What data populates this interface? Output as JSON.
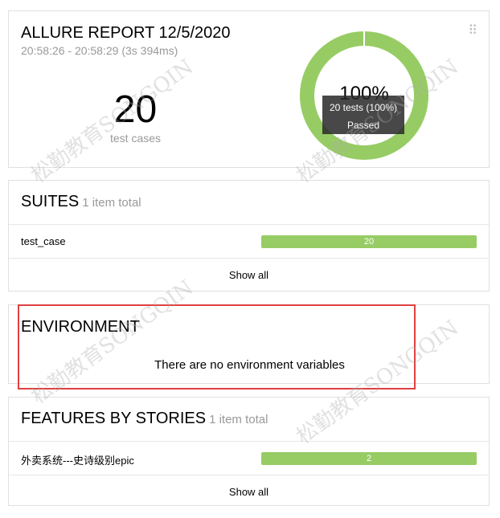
{
  "summary": {
    "title": "ALLURE REPORT 12/5/2020",
    "time_range": "20:58:26 - 20:58:29 (3s 394ms)",
    "count": "20",
    "count_label": "test cases",
    "pass_percent_label": "100%",
    "pass_fraction": 1.0,
    "tooltip_line1": "20 tests (100%)",
    "tooltip_line2": "Passed",
    "drag_handle_icon": "drag-handle-icon",
    "colors": {
      "passed": "#97cc64"
    }
  },
  "suites": {
    "title": "SUITES",
    "count_text": "1 item total",
    "items": [
      {
        "name": "test_case",
        "value": "20"
      }
    ],
    "show_all": "Show all"
  },
  "environment": {
    "title": "ENVIRONMENT",
    "empty_text": "There are no environment variables"
  },
  "features": {
    "title": "FEATURES BY STORIES",
    "count_text": "1 item total",
    "items": [
      {
        "name": "外卖系统---史诗级别epic",
        "value": "2"
      }
    ],
    "show_all": "Show all"
  },
  "watermark": {
    "text": "松勤教育SONGQIN"
  },
  "annotation": {
    "highlight_color": "#e04040"
  }
}
